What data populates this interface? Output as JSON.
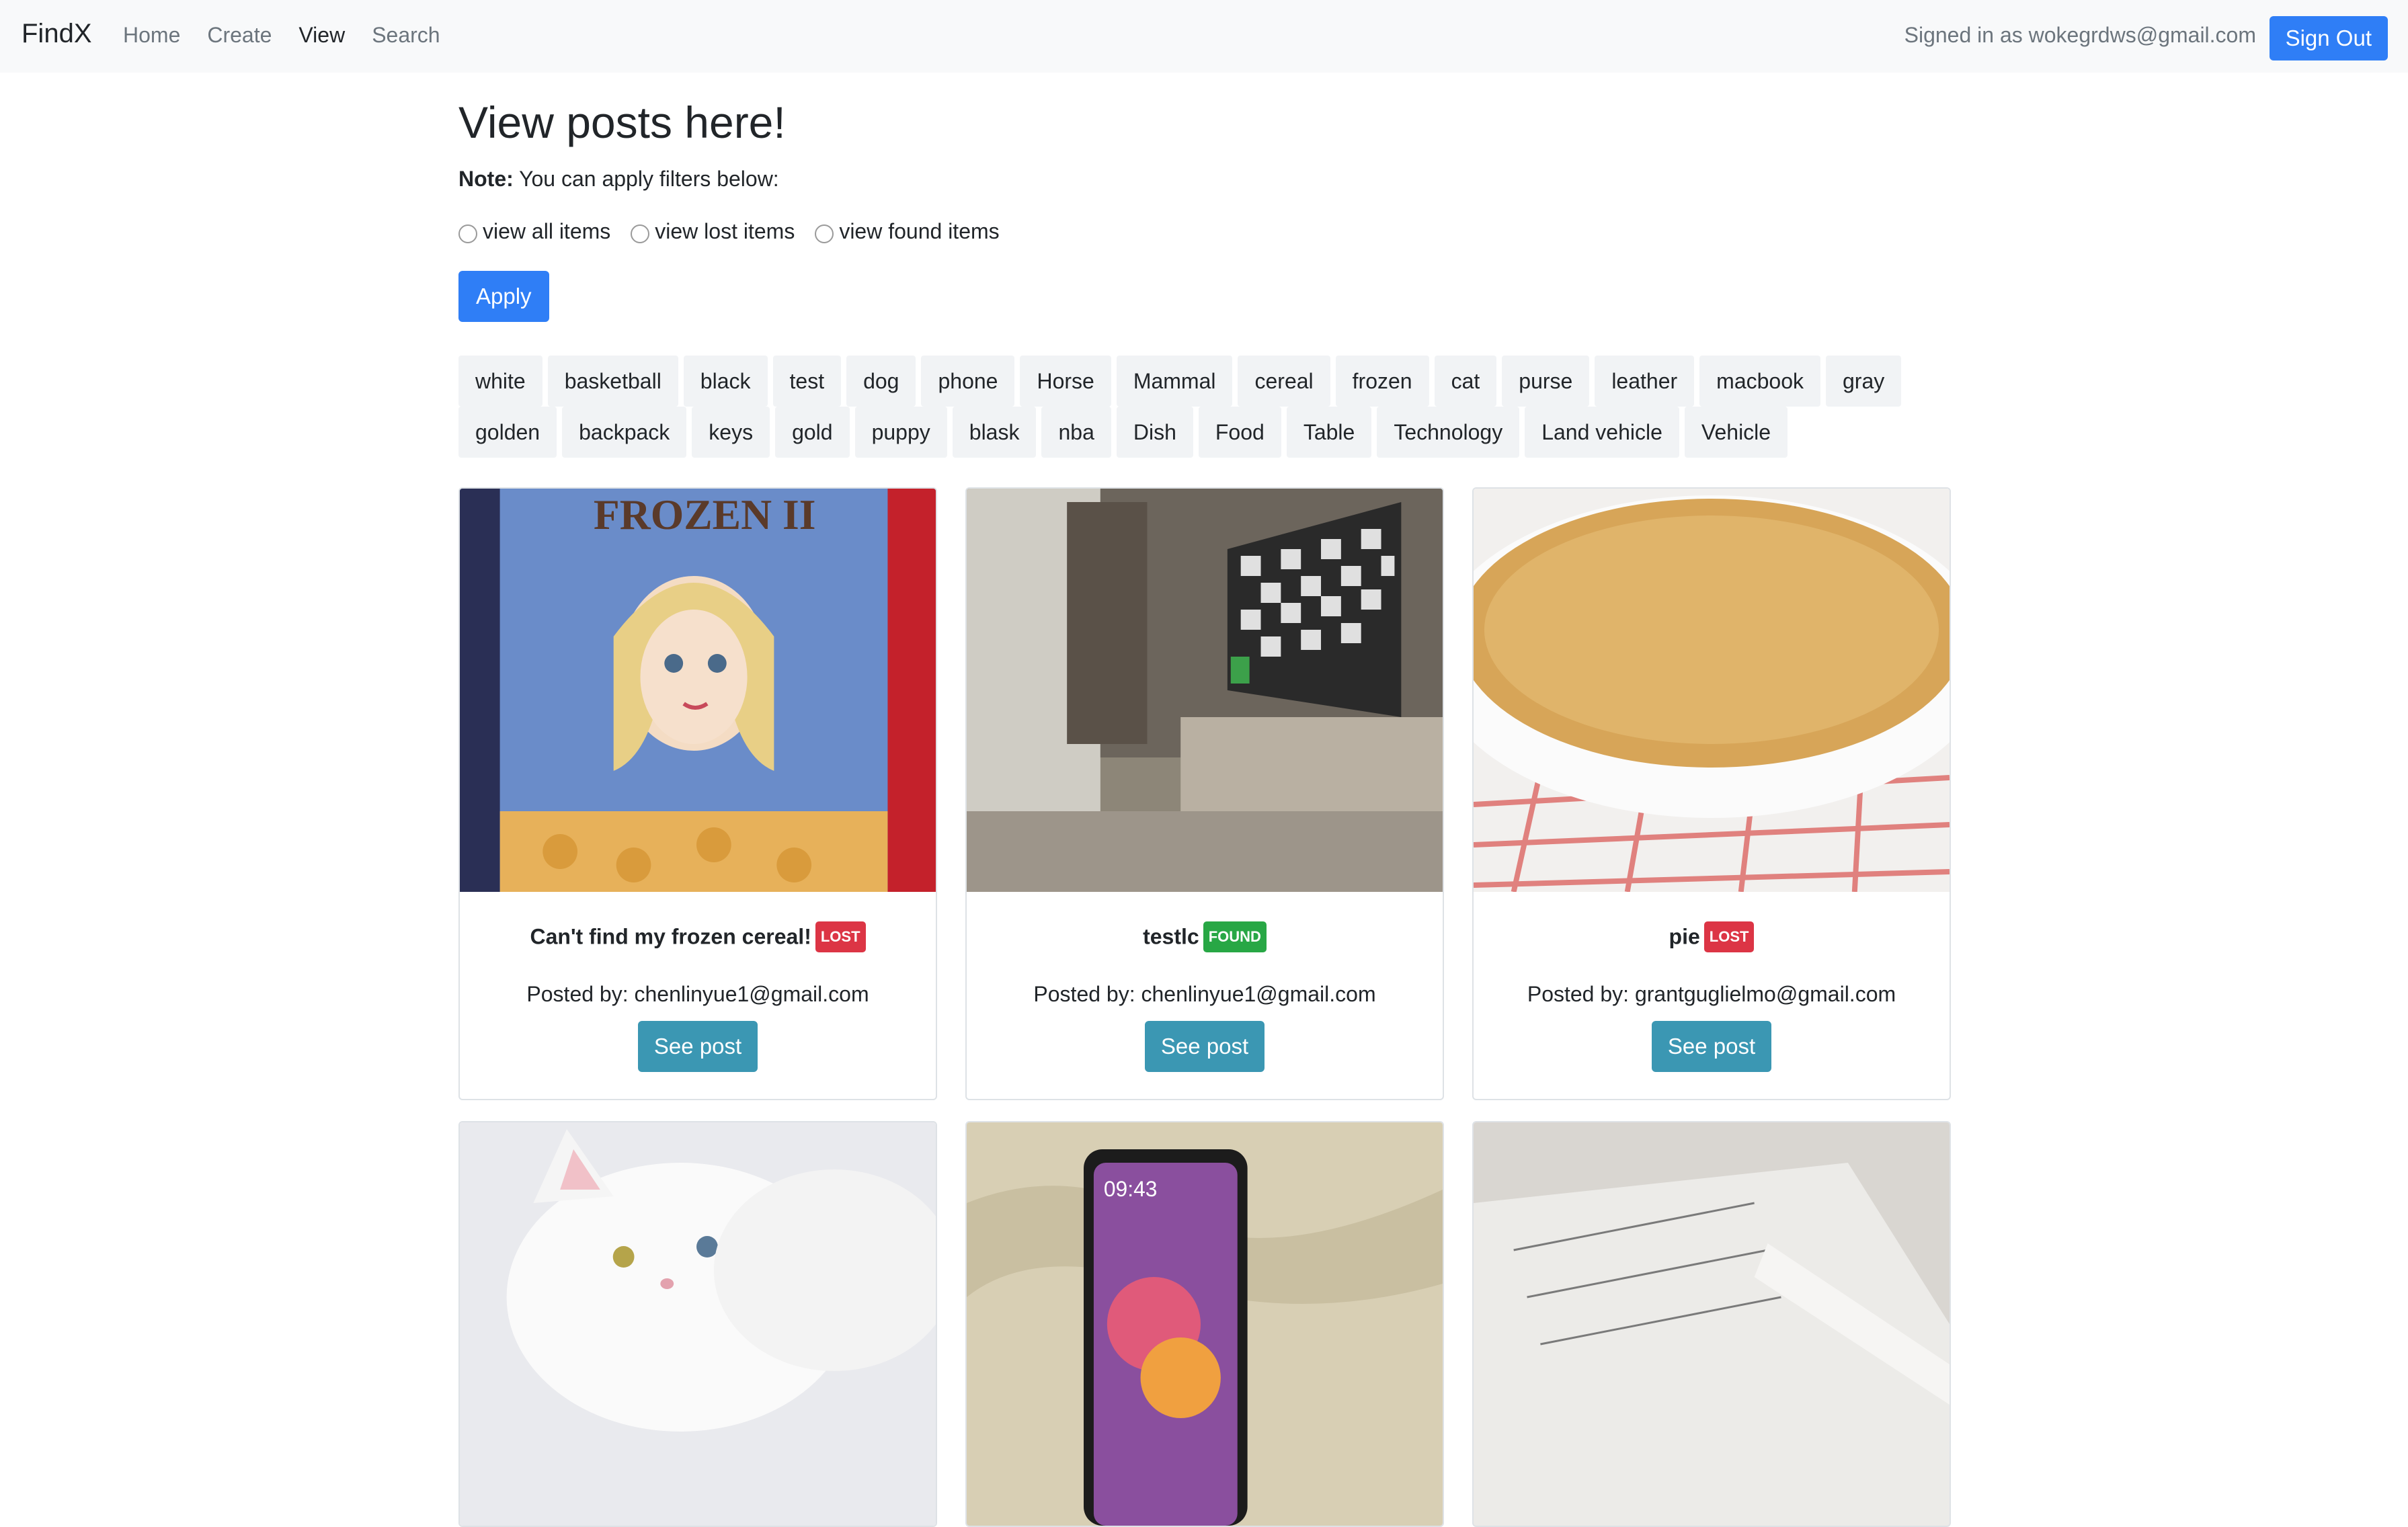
{
  "navbar": {
    "brand": "FindX",
    "links": [
      "Home",
      "Create",
      "View",
      "Search"
    ],
    "active_link": "View",
    "signed_in_text": "Signed in as wokegrdws@gmail.com",
    "signout_label": "Sign Out"
  },
  "main": {
    "title": "View posts here!",
    "note_label": "Note:",
    "note_text": " You can apply filters below:",
    "filters": [
      "view all items",
      "view lost items",
      "view found items"
    ],
    "apply_label": "Apply"
  },
  "tags": {
    "row1": [
      "white",
      "basketball",
      "black",
      "test",
      "dog",
      "phone",
      "Horse",
      "Mammal",
      "cereal",
      "frozen",
      "cat",
      "purse",
      "leather",
      "macbook",
      "gray"
    ],
    "row2": [
      "golden",
      "backpack",
      "keys",
      "gold",
      "puppy",
      "blask",
      "nba",
      "Dish",
      "Food",
      "Table",
      "Technology",
      "Land vehicle",
      "Vehicle"
    ]
  },
  "posts": [
    {
      "title": "Can't find my frozen cereal!",
      "status": "LOST",
      "posted_by": "Posted by: chenlinyue1@gmail.com",
      "button": "See post",
      "image": "frozen-cereal-box"
    },
    {
      "title": "testlc",
      "status": "FOUND",
      "posted_by": "Posted by: chenlinyue1@gmail.com",
      "button": "See post",
      "image": "living-room-tv"
    },
    {
      "title": "pie",
      "status": "LOST",
      "posted_by": "Posted by: grantguglielmo@gmail.com",
      "button": "See post",
      "image": "pie-crust"
    },
    {
      "image": "white-cat"
    },
    {
      "image": "smartphone-on-map"
    },
    {
      "image": "papers-on-table"
    }
  ],
  "colors": {
    "primary": "#2f7ef6",
    "info": "#3b97b3",
    "lost": "#dc3545",
    "found": "#28a745",
    "navbar_bg": "#f8f9fa"
  }
}
